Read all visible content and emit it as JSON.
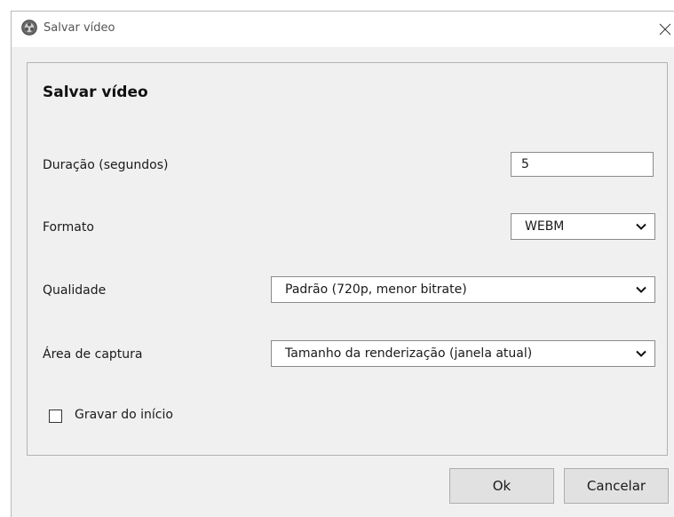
{
  "window": {
    "title": "Salvar vídeo",
    "icon": "app-logo-icon",
    "close_icon": "close-icon"
  },
  "panel": {
    "title": "Salvar vídeo"
  },
  "fields": {
    "duration": {
      "label": "Duração (segundos)",
      "value": "5"
    },
    "format": {
      "label": "Formato",
      "selected": "WEBM"
    },
    "quality": {
      "label": "Qualidade",
      "selected": "Padrão (720p, menor bitrate)"
    },
    "capture_area": {
      "label": "Área de captura",
      "selected": "Tamanho da renderização (janela atual)"
    },
    "record_from_start": {
      "label": "Gravar do início",
      "checked": false
    }
  },
  "buttons": {
    "ok": "Ok",
    "cancel": "Cancelar"
  }
}
